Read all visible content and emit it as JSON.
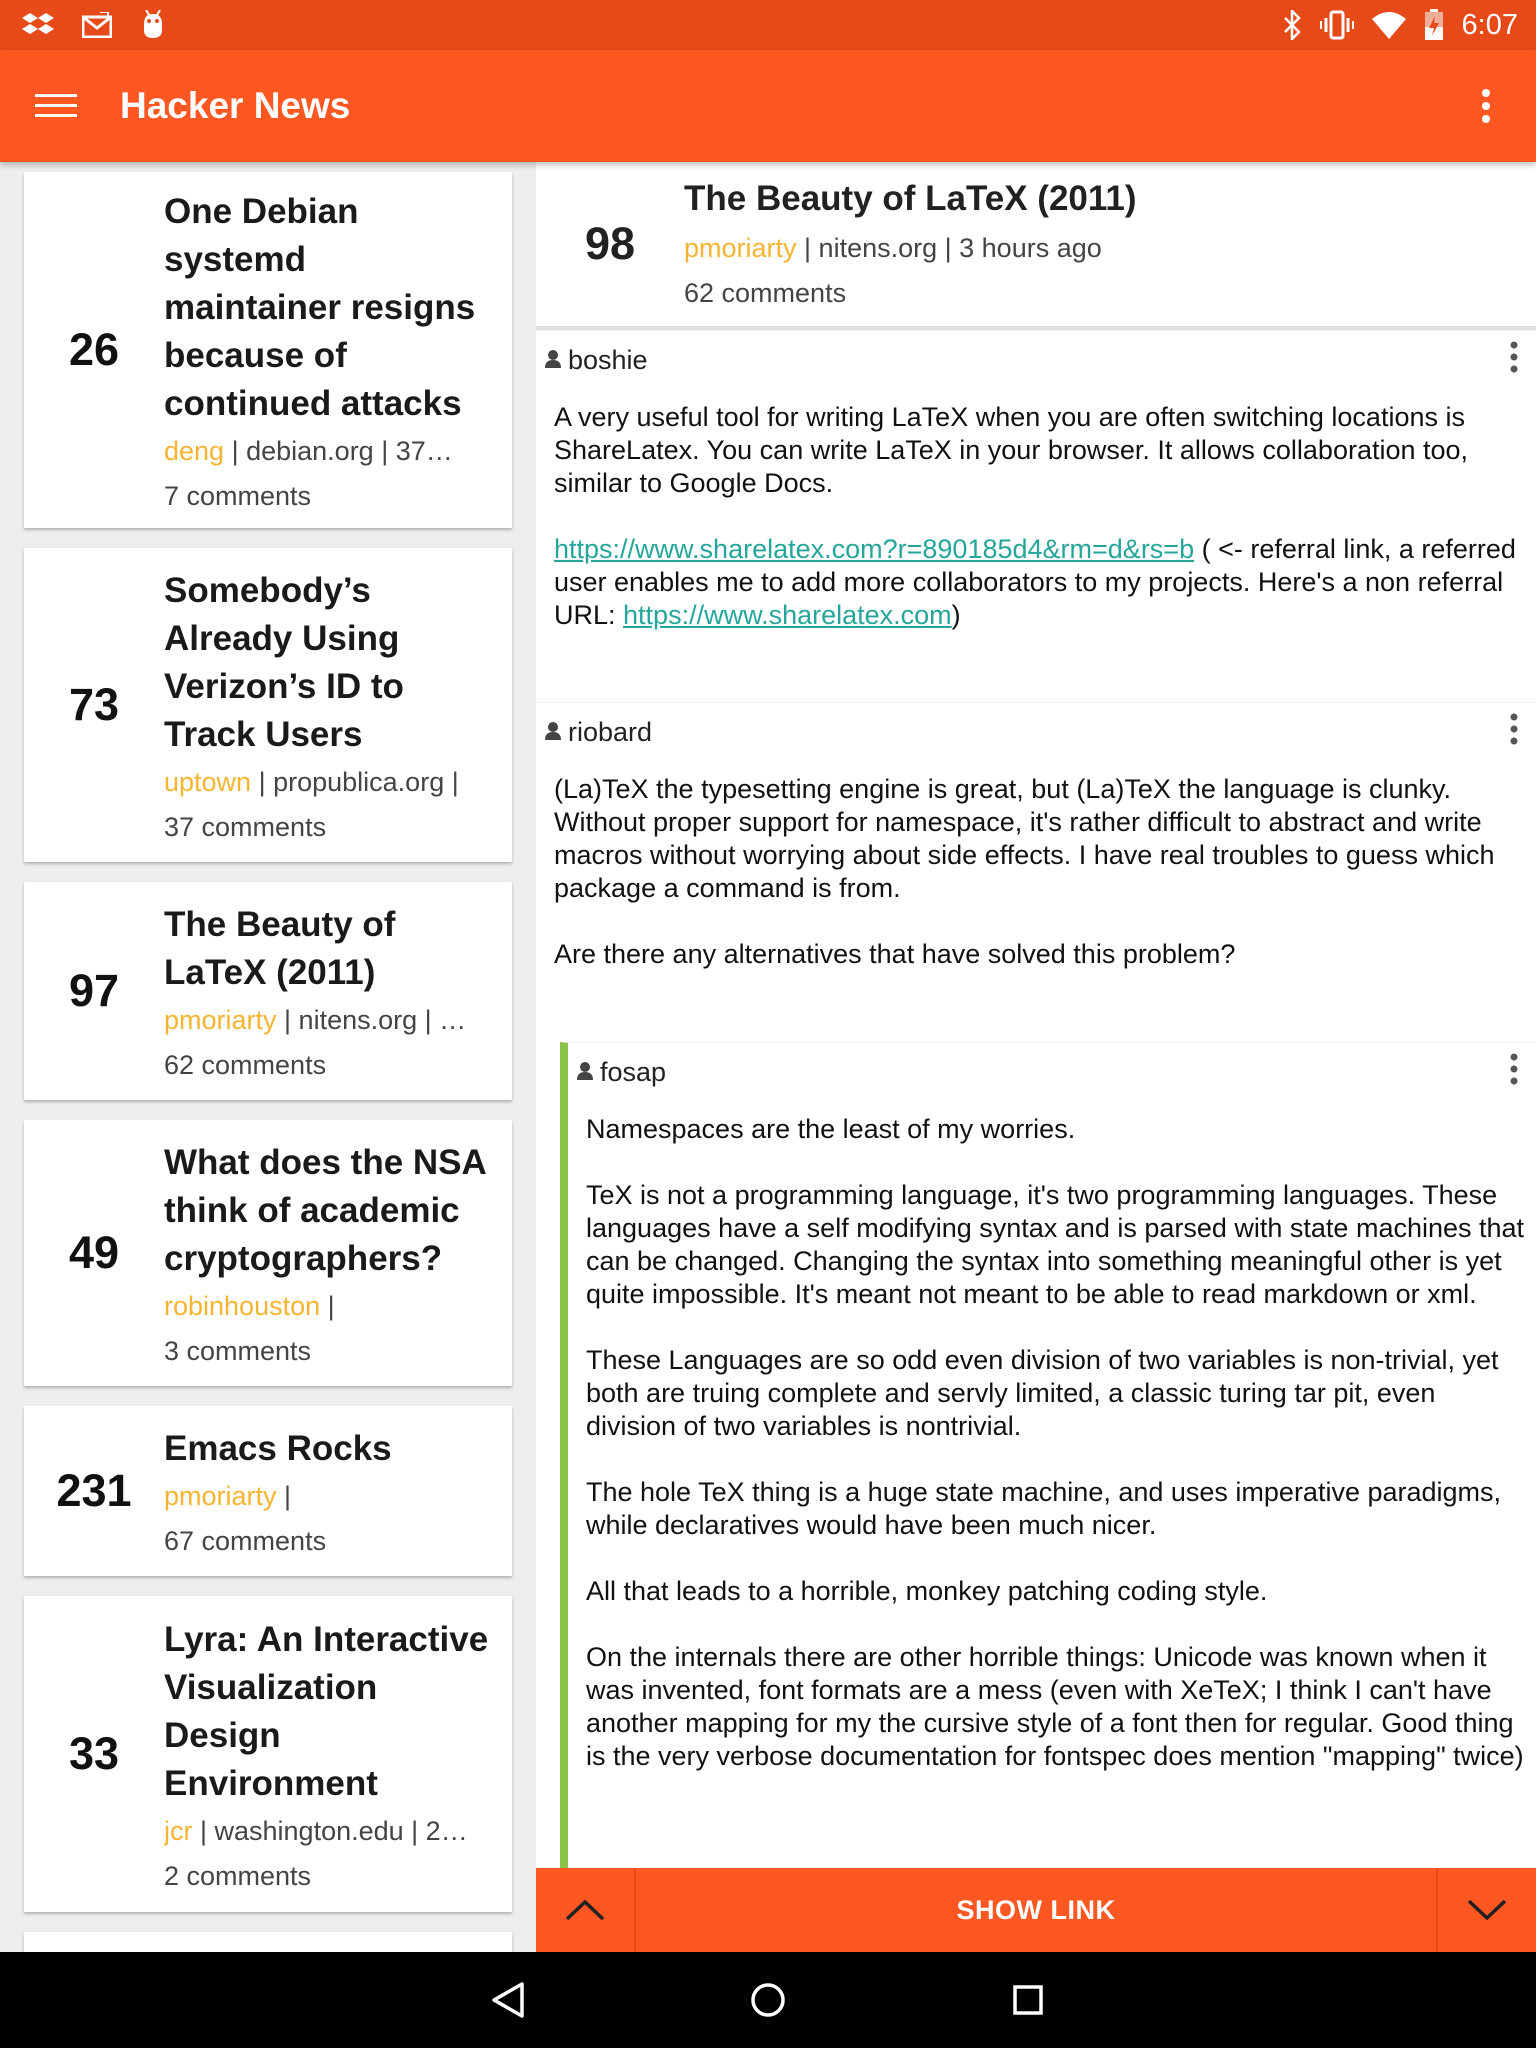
{
  "status_bar": {
    "time": "6:07",
    "left_icons": [
      "dropbox-icon",
      "gmail-icon",
      "android-debug-icon"
    ],
    "right_icons": [
      "bluetooth-icon",
      "vibrate-icon",
      "wifi-icon",
      "battery-charging-icon"
    ]
  },
  "appbar": {
    "title": "Hacker News",
    "menu_icon": "hamburger-menu-icon",
    "overflow_icon": "more-vert-icon"
  },
  "stories": [
    {
      "score": "26",
      "title": "One Debian systemd maintainer resigns because of continued attacks",
      "author": "deng",
      "meta": " | debian.org | 37…",
      "comments": "7 comments"
    },
    {
      "score": "73",
      "title": "Somebody’s Already Using Verizon’s ID to Track Users",
      "author": "uptown",
      "meta": " | propublica.org |",
      "comments": "37 comments"
    },
    {
      "score": "97",
      "title": "The Beauty of LaTeX (2011)",
      "author": "pmoriarty",
      "meta": " | nitens.org | …",
      "comments": "62 comments"
    },
    {
      "score": "49",
      "title": "What does the NSA think of academic cryptographers?",
      "author": "robinhouston",
      "meta": " |",
      "comments": "3 comments"
    },
    {
      "score": "231",
      "title": "Emacs Rocks",
      "author": "pmoriarty",
      "meta": " |",
      "comments": "67 comments"
    },
    {
      "score": "33",
      "title": "Lyra: An Interactive Visualization Design Environment",
      "author": "jcr",
      "meta": " | washington.edu | 2…",
      "comments": "2 comments"
    }
  ],
  "detail": {
    "score": "98",
    "title": "The Beauty of LaTeX (2011)",
    "author": "pmoriarty",
    "meta": " | nitens.org | 3 hours ago",
    "comments": "62 comments"
  },
  "comments": [
    {
      "user": "boshie",
      "p1": "A very useful tool for writing LaTeX when you are often switching locations is ShareLatex. You can write LaTeX in your browser. It allows collaboration too, similar to Google Docs.",
      "link1": "https://www.sharelatex.com?r=890185d4&rm=d&rs=b",
      "p2_mid": " ( <- referral link, a referred user enables me to add more collaborators to my projects. Here's a non referral URL: ",
      "link2": "https://www.sharelatex.com",
      "p2_end": ")"
    },
    {
      "user": "riobard",
      "p1": "(La)TeX the typesetting engine is great, but (La)TeX the language is clunky. Without proper support for namespace, it's rather difficult to abstract and write macros without worrying about side effects. I have real troubles to guess which package a command is from.",
      "p2": "Are there any alternatives that have solved this problem?"
    },
    {
      "user": "fosap",
      "p1": "Namespaces are the least of my worries.",
      "p2": "TeX is not a programming language, it's two programming languages. These languages have a self modifying syntax and is parsed with state machines that can be changed. Changing the syntax into something meaningful other is yet quite impossible. It's meant not meant to be able to read markdown or xml.",
      "p3": "These Languages are so odd even division of two variables is non-trivial, yet both are truing complete and servly limited, a classic turing tar pit, even division of two variables is nontrivial.",
      "p4": "The hole TeX thing is a huge state machine, and uses imperative paradigms, while declaratives would have been much nicer.",
      "p5": "All that leads to a horrible, monkey patching coding style.",
      "p6": "On the internals there are other horrible things: Unicode was known when it was invented, font formats are a mess (even with XeTeX; I think I can't have another mapping for my the cursive style of a font then for regular. Good thing is the very verbose documentation for fontspec does mention \"mapping\" twice)"
    }
  ],
  "action_bar": {
    "show_link": "SHOW LINK",
    "prev_icon": "chevron-up-icon",
    "next_icon": "chevron-down-icon"
  },
  "system_nav": [
    "back-icon",
    "home-icon",
    "recents-icon"
  ],
  "colors": {
    "primary": "#ff5722",
    "primary_dark": "#e64a19",
    "author": "#f5b431",
    "link": "#26a69a",
    "thread_line": "#8bc34a"
  }
}
